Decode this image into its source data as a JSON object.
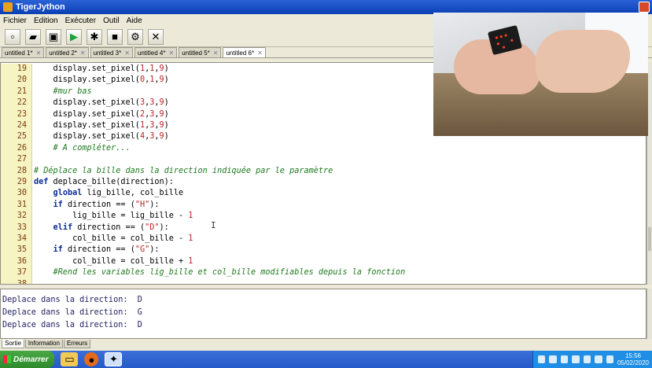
{
  "window": {
    "title": "TigerJython"
  },
  "menu": [
    "Fichier",
    "Edition",
    "Exécuter",
    "Outil",
    "Aide"
  ],
  "toolbar": [
    {
      "name": "new-file-icon",
      "glyph": "▫"
    },
    {
      "name": "open-folder-icon",
      "glyph": "▰"
    },
    {
      "name": "save-icon",
      "glyph": "▣"
    },
    {
      "name": "run-icon",
      "glyph": "▶"
    },
    {
      "name": "debug-icon",
      "glyph": "✱"
    },
    {
      "name": "stop-icon",
      "glyph": "■"
    },
    {
      "name": "settings-icon",
      "glyph": "⚙"
    },
    {
      "name": "tools-icon",
      "glyph": "✕"
    }
  ],
  "tabs": [
    "untitled 1*",
    "untitled 2*",
    "untitled 3*",
    "untitled 4*",
    "untitled 5*",
    "untitled 6*"
  ],
  "active_tab": 5,
  "code": [
    {
      "n": "19",
      "text": "    display.set_pixel(1,1,9)"
    },
    {
      "n": "20",
      "text": "    display.set_pixel(0,1,9)"
    },
    {
      "n": "21",
      "text": "    #mur bas",
      "type": "comment"
    },
    {
      "n": "22",
      "text": "    display.set_pixel(3,3,9)"
    },
    {
      "n": "23",
      "text": "    display.set_pixel(2,3,9)"
    },
    {
      "n": "24",
      "text": "    display.set_pixel(1,3,9)"
    },
    {
      "n": "25",
      "text": "    display.set_pixel(4,3,9)"
    },
    {
      "n": "26",
      "text": "    # A compléter...",
      "type": "comment"
    },
    {
      "n": "27",
      "text": ""
    },
    {
      "n": "28",
      "text": "# Déplace la bille dans la direction indiquée par le paramètre",
      "type": "comment"
    },
    {
      "n": "29",
      "text": "def deplace_bille(direction):",
      "type": "def"
    },
    {
      "n": "30",
      "text": "    global lig_bille, col_bille",
      "type": "global"
    },
    {
      "n": "31",
      "text": "    if direction == (\"H\"):",
      "type": "if"
    },
    {
      "n": "32",
      "text": "        lig_bille = lig_bille - 1",
      "type": "assign"
    },
    {
      "n": "33",
      "text": "    elif direction == (\"D\"):",
      "type": "elif"
    },
    {
      "n": "34",
      "text": "        col_bille = col_bille - 1",
      "type": "assign"
    },
    {
      "n": "35",
      "text": "    if direction == (\"G\"):",
      "type": "if"
    },
    {
      "n": "36",
      "text": "        col_bille = col_bille + 1",
      "type": "assign"
    },
    {
      "n": "37",
      "text": "    #Rend les variables lig_bille et col_bille modifiables depuis la fonction",
      "type": "comment"
    },
    {
      "n": "38",
      "text": ""
    }
  ],
  "output": [
    "Deplace dans la direction:  D",
    "Deplace dans la direction:  G",
    "Deplace dans la direction:  D"
  ],
  "bottom_tabs": [
    "Sortie",
    "Information",
    "Erreurs"
  ],
  "taskbar": {
    "start_label": "Démarrer",
    "clock_time": "15:56",
    "clock_date": "05/02/2020"
  }
}
